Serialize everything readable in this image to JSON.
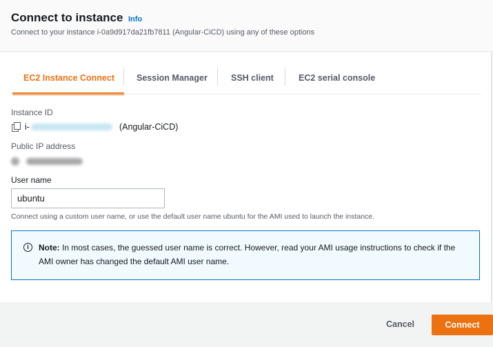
{
  "dialog": {
    "title": "Connect to instance",
    "info_link": "Info",
    "subtitle": "Connect to your instance i-0a9d917da21fb7811 (Angular-CiCD) using any of these options"
  },
  "tabs": [
    {
      "label": "EC2 Instance Connect",
      "active": true
    },
    {
      "label": "Session Manager",
      "active": false
    },
    {
      "label": "SSH client",
      "active": false
    },
    {
      "label": "EC2 serial console",
      "active": false
    }
  ],
  "instance": {
    "id_label": "Instance ID",
    "id_prefix": "i-",
    "name_suffix": "(Angular-CiCD)",
    "public_ip_label": "Public IP address"
  },
  "username": {
    "label": "User name",
    "value": "ubuntu",
    "hint": "Connect using a custom user name, or use the default user name ubuntu for the AMI used to launch the instance."
  },
  "note": {
    "bold": "Note:",
    "text": " In most cases, the guessed user name is correct. However, read your AMI usage instructions to check if the AMI owner has changed the default AMI user name."
  },
  "footer": {
    "cancel_label": "Cancel",
    "connect_label": "Connect"
  },
  "colors": {
    "accent": "#ec7211",
    "link": "#0073bb",
    "note_bg": "#f1faff"
  }
}
